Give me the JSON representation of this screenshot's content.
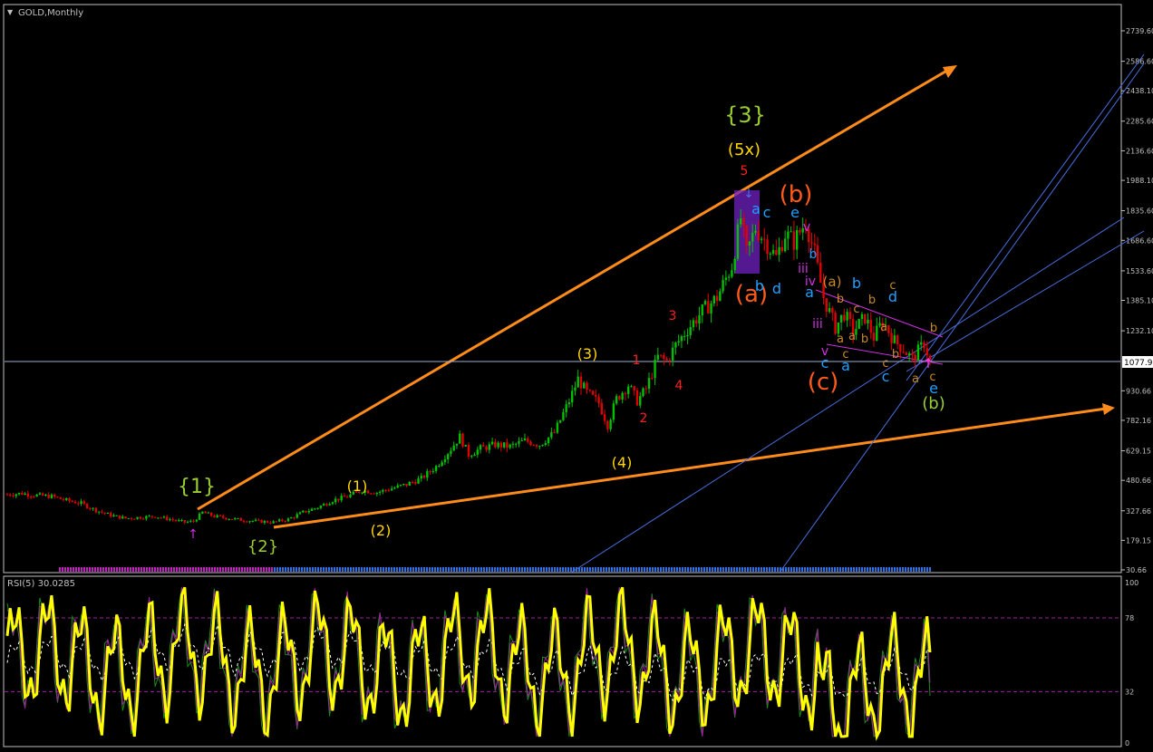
{
  "window": {
    "main_title": "GOLD,Monthly",
    "indicator_title": "RSI(5) 30.0285",
    "menu_glyph": "▼"
  },
  "colors": {
    "background": "#000000",
    "grid_frame": "#c0c0c0",
    "candle_up": "#00c000",
    "candle_down": "#e00000",
    "trend_orange": "#ff8c1a",
    "fan_blue": "#4a6ee0",
    "price_line": "#9fb0d0",
    "rsi": "#ffff00",
    "rsi_level": "#a020a0",
    "wave_green": "#9acd32",
    "wave_yellow": "#ffd700",
    "wave_red": "#ff2020",
    "wave_orange": "#ff5a1a",
    "wave_cyan": "#1ea0ff",
    "wave_magenta": "#d030e0",
    "wave_brown": "#c8882a"
  },
  "chart_data": [
    {
      "type": "candlestick",
      "title": "GOLD,Monthly",
      "y_ticks": [
        "2739.60",
        "2586.60",
        "2438.10",
        "2285.60",
        "2136.60",
        "1988.10",
        "1835.60",
        "1686.60",
        "1533.60",
        "1385.10",
        "1232.10",
        "930.66",
        "782.16",
        "629.15",
        "480.66",
        "327.66",
        "179.15",
        "30.66"
      ],
      "current_price": "1077.95",
      "ylim": [
        30.66,
        2739.6
      ],
      "price_path": [
        {
          "t": 0,
          "p": 410
        },
        {
          "t": 5,
          "p": 415
        },
        {
          "t": 10,
          "p": 405
        },
        {
          "t": 15,
          "p": 400
        },
        {
          "t": 20,
          "p": 380
        },
        {
          "t": 25,
          "p": 365
        },
        {
          "t": 30,
          "p": 330
        },
        {
          "t": 35,
          "p": 305
        },
        {
          "t": 40,
          "p": 290
        },
        {
          "t": 45,
          "p": 295
        },
        {
          "t": 50,
          "p": 300
        },
        {
          "t": 55,
          "p": 285
        },
        {
          "t": 60,
          "p": 270
        },
        {
          "t": 63,
          "p": 275
        },
        {
          "t": 66,
          "p": 320
        },
        {
          "t": 70,
          "p": 300
        },
        {
          "t": 75,
          "p": 290
        },
        {
          "t": 80,
          "p": 280
        },
        {
          "t": 85,
          "p": 275
        },
        {
          "t": 90,
          "p": 270
        },
        {
          "t": 95,
          "p": 285
        },
        {
          "t": 100,
          "p": 320
        },
        {
          "t": 105,
          "p": 345
        },
        {
          "t": 110,
          "p": 380
        },
        {
          "t": 115,
          "p": 400
        },
        {
          "t": 120,
          "p": 430
        },
        {
          "t": 125,
          "p": 420
        },
        {
          "t": 130,
          "p": 440
        },
        {
          "t": 135,
          "p": 460
        },
        {
          "t": 140,
          "p": 490
        },
        {
          "t": 145,
          "p": 550
        },
        {
          "t": 150,
          "p": 640
        },
        {
          "t": 153,
          "p": 700
        },
        {
          "t": 156,
          "p": 610
        },
        {
          "t": 160,
          "p": 640
        },
        {
          "t": 165,
          "p": 660
        },
        {
          "t": 170,
          "p": 650
        },
        {
          "t": 175,
          "p": 680
        },
        {
          "t": 180,
          "p": 660
        },
        {
          "t": 185,
          "p": 720
        },
        {
          "t": 190,
          "p": 880
        },
        {
          "t": 193,
          "p": 990
        },
        {
          "t": 196,
          "p": 920
        },
        {
          "t": 200,
          "p": 870
        },
        {
          "t": 203,
          "p": 760
        },
        {
          "t": 206,
          "p": 890
        },
        {
          "t": 210,
          "p": 960
        },
        {
          "t": 213,
          "p": 880
        },
        {
          "t": 216,
          "p": 940
        },
        {
          "t": 220,
          "p": 1100
        },
        {
          "t": 223,
          "p": 1080
        },
        {
          "t": 226,
          "p": 1160
        },
        {
          "t": 230,
          "p": 1240
        },
        {
          "t": 235,
          "p": 1330
        },
        {
          "t": 240,
          "p": 1400
        },
        {
          "t": 245,
          "p": 1560
        },
        {
          "t": 248,
          "p": 1800
        },
        {
          "t": 250,
          "p": 1620
        },
        {
          "t": 253,
          "p": 1750
        },
        {
          "t": 256,
          "p": 1690
        },
        {
          "t": 260,
          "p": 1600
        },
        {
          "t": 263,
          "p": 1720
        },
        {
          "t": 266,
          "p": 1680
        },
        {
          "t": 270,
          "p": 1780
        },
        {
          "t": 273,
          "p": 1620
        },
        {
          "t": 276,
          "p": 1400
        },
        {
          "t": 280,
          "p": 1250
        },
        {
          "t": 283,
          "p": 1320
        },
        {
          "t": 286,
          "p": 1230
        },
        {
          "t": 290,
          "p": 1300
        },
        {
          "t": 293,
          "p": 1200
        },
        {
          "t": 296,
          "p": 1280
        },
        {
          "t": 300,
          "p": 1180
        },
        {
          "t": 303,
          "p": 1140
        },
        {
          "t": 306,
          "p": 1090
        },
        {
          "t": 310,
          "p": 1170
        },
        {
          "t": 312,
          "p": 1078
        }
      ]
    },
    {
      "type": "line",
      "title": "RSI(5) 30.0285",
      "y_ticks": [
        "100",
        "78",
        "32",
        "0"
      ],
      "ylim": [
        0,
        100
      ],
      "levels": [
        78,
        32
      ]
    }
  ],
  "wave_labels": [
    {
      "text": "{1}",
      "color": "#9acd32",
      "size": 22
    },
    {
      "text": "{2}",
      "color": "#9acd32",
      "size": 18
    },
    {
      "text": "(1)",
      "color": "#ffd700",
      "size": 16
    },
    {
      "text": "(2)",
      "color": "#ffd700",
      "size": 16
    },
    {
      "text": "(3)",
      "color": "#ffd700",
      "size": 16
    },
    {
      "text": "(4)",
      "color": "#ffd700",
      "size": 16
    },
    {
      "text": "1",
      "color": "#ff2020",
      "size": 14
    },
    {
      "text": "2",
      "color": "#ff2020",
      "size": 14
    },
    {
      "text": "3",
      "color": "#ff2020",
      "size": 14
    },
    {
      "text": "4",
      "color": "#ff2020",
      "size": 14
    },
    {
      "text": "5",
      "color": "#ff2020",
      "size": 14
    },
    {
      "text": "{3}",
      "color": "#9acd32",
      "size": 24
    },
    {
      "text": "(5x)",
      "color": "#ffd700",
      "size": 18
    },
    {
      "text": "(a)",
      "color": "#ff5a1a",
      "size": 26
    },
    {
      "text": "(b)",
      "color": "#ff5a1a",
      "size": 26
    },
    {
      "text": "(c)",
      "color": "#ff5a1a",
      "size": 26
    },
    {
      "text": "(b)",
      "color": "#9acd32",
      "size": 18
    },
    {
      "text": "a",
      "color": "#1ea0ff",
      "size": 16
    },
    {
      "text": "c",
      "color": "#1ea0ff",
      "size": 16
    },
    {
      "text": "b",
      "color": "#1ea0ff",
      "size": 16
    },
    {
      "text": "d",
      "color": "#1ea0ff",
      "size": 16
    },
    {
      "text": "e",
      "color": "#1ea0ff",
      "size": 16
    },
    {
      "text": "a",
      "color": "#1ea0ff",
      "size": 16
    },
    {
      "text": "c",
      "color": "#1ea0ff",
      "size": 16
    },
    {
      "text": "a",
      "color": "#1ea0ff",
      "size": 16
    },
    {
      "text": "b",
      "color": "#1ea0ff",
      "size": 16
    },
    {
      "text": "d",
      "color": "#1ea0ff",
      "size": 16
    },
    {
      "text": "c",
      "color": "#1ea0ff",
      "size": 16
    },
    {
      "text": "e",
      "color": "#1ea0ff",
      "size": 16
    },
    {
      "text": "v",
      "color": "#d030e0",
      "size": 14
    },
    {
      "text": "iii",
      "color": "#d030e0",
      "size": 14
    },
    {
      "text": "iv",
      "color": "#d030e0",
      "size": 14
    },
    {
      "text": "iii",
      "color": "#d030e0",
      "size": 14
    },
    {
      "text": "v",
      "color": "#d030e0",
      "size": 14
    },
    {
      "text": "b",
      "color": "#1ea0ff",
      "size": 14
    },
    {
      "text": "(a)",
      "color": "#c8882a",
      "size": 15
    },
    {
      "text": "b",
      "color": "#c8882a",
      "size": 13
    },
    {
      "text": "c",
      "color": "#c8882a",
      "size": 13
    },
    {
      "text": "b",
      "color": "#c8882a",
      "size": 13
    },
    {
      "text": "a",
      "color": "#c8882a",
      "size": 13
    },
    {
      "text": "c",
      "color": "#c8882a",
      "size": 13
    },
    {
      "text": "a",
      "color": "#c8882a",
      "size": 13
    },
    {
      "text": "b",
      "color": "#c8882a",
      "size": 13
    },
    {
      "text": "a",
      "color": "#c8882a",
      "size": 13
    },
    {
      "text": "c",
      "color": "#c8882a",
      "size": 13
    },
    {
      "text": "c",
      "color": "#c8882a",
      "size": 13
    },
    {
      "text": "b",
      "color": "#c8882a",
      "size": 13
    },
    {
      "text": "a",
      "color": "#c8882a",
      "size": 13
    },
    {
      "text": "c",
      "color": "#c8882a",
      "size": 13
    },
    {
      "text": "b",
      "color": "#c8882a",
      "size": 13
    }
  ]
}
